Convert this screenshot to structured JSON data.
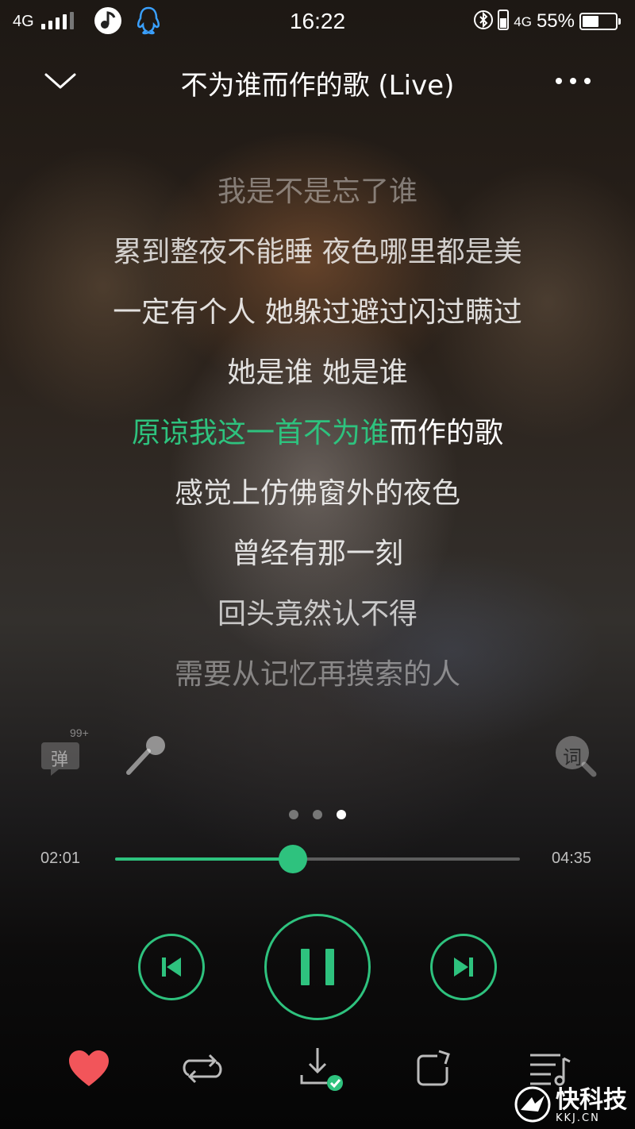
{
  "status_bar": {
    "network_left": "4G",
    "time": "16:22",
    "network_right": "4G",
    "battery_percent": "55%",
    "battery_level": 0.55
  },
  "header": {
    "title": "不为谁而作的歌 (Live)"
  },
  "lyrics": {
    "lines": [
      {
        "text": "我是不是忘了谁"
      },
      {
        "text": "累到整夜不能睡 夜色哪里都是美"
      },
      {
        "text": "一定有个人 她躲过避过闪过瞒过"
      },
      {
        "text": "她是谁 她是谁"
      },
      {
        "text_sung": "原谅我这一首不为谁",
        "text_rest": "而作的歌"
      },
      {
        "text": "感觉上仿佛窗外的夜色"
      },
      {
        "text": "曾经有那一刻"
      },
      {
        "text": "回头竟然认不得"
      },
      {
        "text": "需要从记忆再摸索的人"
      }
    ],
    "current_line_progress": 0.55
  },
  "tools": {
    "danmaku_label": "弹",
    "danmaku_badge": "99+",
    "lyric_search_label": "词"
  },
  "pager": {
    "count": 3,
    "active_index": 2
  },
  "player": {
    "elapsed": "02:01",
    "duration": "04:35",
    "progress": 0.44
  },
  "colors": {
    "accent": "#2ec27e",
    "heart": "#f2555a"
  },
  "icons": {
    "collapse": "chevron-down-icon",
    "more": "more-icon",
    "previous": "previous-icon",
    "pause": "pause-icon",
    "next": "next-icon",
    "like": "heart-icon",
    "repeat": "repeat-icon",
    "download": "download-done-icon",
    "share": "share-icon",
    "playlist": "playlist-icon",
    "microphone": "microphone-icon"
  },
  "watermark": {
    "cn": "快科技",
    "en": "KKJ.CN"
  }
}
